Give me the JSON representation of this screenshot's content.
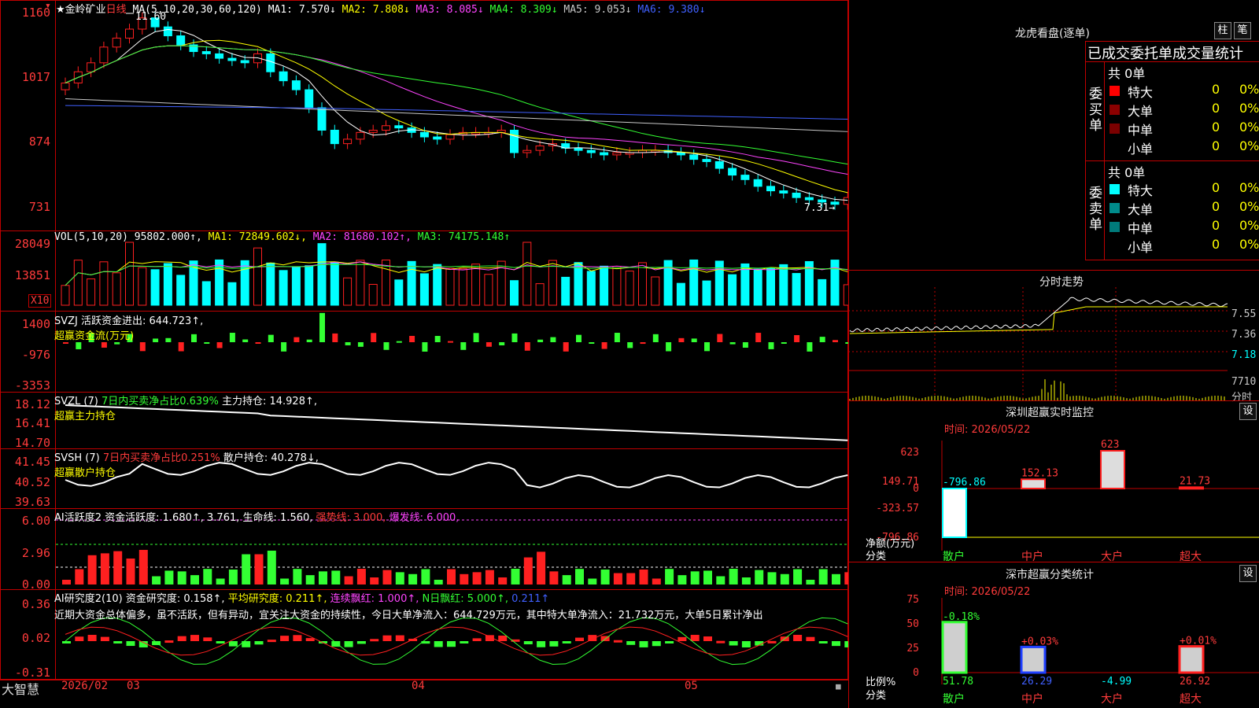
{
  "stock": {
    "name": "★金岭矿业",
    "period": "日线",
    "ma_label": "MA(5,10,20,30,60,120)",
    "ma": [
      {
        "k": "MA1:",
        "v": "7.570↓",
        "c": "#ffffff"
      },
      {
        "k": "MA2:",
        "v": "7.808↓",
        "c": "#ffff00"
      },
      {
        "k": "MA3:",
        "v": "8.085↓",
        "c": "#ff44ff"
      },
      {
        "k": "MA4:",
        "v": "8.309↓",
        "c": "#33ff33"
      },
      {
        "k": "MA5:",
        "v": "9.053↓",
        "c": "#c8c8c8"
      },
      {
        "k": "MA6:",
        "v": "9.380↓",
        "c": "#4060ff"
      }
    ],
    "price_axis": [
      "1160",
      "1017",
      "874",
      "731"
    ],
    "high_label": "11.60",
    "low_label": "7.31→"
  },
  "vol": {
    "label": "VOL(5,10,20)",
    "val": "95802.000↑,",
    "ma1": "MA1: 72849.602↓,",
    "ma2": "MA2: 81680.102↑,",
    "ma3": "MA3: 74175.148↑",
    "axis": [
      "28049",
      "13851"
    ],
    "unit": "X10"
  },
  "svzj": {
    "label": "SVZJ  活跃资金进出: 644.723↑,",
    "sub": "超赢资金流(万元)",
    "axis": [
      "1400",
      "-976",
      "-3353"
    ]
  },
  "svzl": {
    "label": "SVZL (7)",
    "pct": "7日内买卖净占比0.639%",
    "hold": "主力持仓: 14.928↑,",
    "sub": "超赢主力持仓",
    "axis": [
      "18.12",
      "16.41",
      "14.70"
    ]
  },
  "svsh": {
    "label": "SVSH (7)",
    "pct": "7日内买卖净占比0.251%",
    "hold": "散户持仓: 40.278↓,",
    "sub": "超赢散户持仓",
    "axis": [
      "41.45",
      "40.52",
      "39.63"
    ]
  },
  "ai1": {
    "l1": "AI活跃度2 资金活跃度: 1.680↑,",
    "l2": "3.761,",
    "l3": "生命线: 1.560,",
    "l4": "强势线: 3.000,",
    "l5": "爆发线: 6.000,",
    "axis": [
      "6.00",
      "2.96",
      "0.00"
    ]
  },
  "ai2": {
    "l1": "AI研究度2(10) 资金研究度: 0.158↑,",
    "l2": "平均研究度: 0.211↑,",
    "l3": "连续飘红: 1.000↑,",
    "l4": "N日飘红: 5.000↑,",
    "l5": "0.211↑",
    "comment": "近期大资金总体偏多，虽不活跃，但有异动，宜关注大资金的持续性，今日大单净流入：644.729万元，其中特大单净流入：21.732万元，大单5日累计净出",
    "axis": [
      "0.36",
      "0.02",
      "-0.31"
    ]
  },
  "xaxis": {
    "brand": "大智慧",
    "labels": [
      "2026/02",
      "03",
      "04",
      "05"
    ]
  },
  "dragon": {
    "title": "龙虎看盘(逐单)",
    "btn1": "柱",
    "btn2": "笔",
    "subtitle": "已成交委托单成交量统计",
    "buy_label": "委买单",
    "sell_label": "委卖单",
    "buy_total": "共 0单",
    "sell_total": "共 0单",
    "rows": [
      "特大",
      "大单",
      "中单",
      "小单"
    ],
    "zero": "0",
    "pct": "0%",
    "buy_colors": [
      "#ff0000",
      "#8b0000",
      "#7a0000",
      "#000000"
    ],
    "sell_colors": [
      "#00ffff",
      "#008b8b",
      "#007a7a",
      "#000000"
    ]
  },
  "intraday": {
    "title": "分时走势",
    "axis": [
      "7.55",
      "7.36",
      "7.18",
      "7710"
    ],
    "unit": "分时"
  },
  "monitor": {
    "title": "深圳超赢实时监控",
    "btn": "设",
    "time": "时间: 2026/05/22",
    "axis": [
      "623",
      "149.71",
      "0",
      "-323.57",
      "-796.86"
    ],
    "ylab1": "净额(万元)",
    "ylab2": "分类",
    "cats": [
      "散户",
      "中户",
      "大户",
      "超大"
    ],
    "values": [
      -796.86,
      152.13,
      623,
      21.73
    ],
    "labels": [
      "-796.86",
      "152.13",
      "623",
      "21.73"
    ]
  },
  "classify": {
    "title": "深市超赢分类统计",
    "btn": "设",
    "time": "时间: 2026/05/22",
    "axis": [
      "75",
      "50",
      "25",
      "0"
    ],
    "ylab1": "比例%",
    "ylab2": "分类",
    "cats": [
      "散户",
      "中户",
      "大户",
      "超大"
    ],
    "values": [
      51.78,
      26.29,
      -4.99,
      26.92
    ],
    "changes": [
      "-0.18%",
      "+0.03%",
      "",
      "+0.01%"
    ],
    "vlabels": [
      "51.78",
      "26.29",
      "-4.99",
      "26.92"
    ]
  }
}
